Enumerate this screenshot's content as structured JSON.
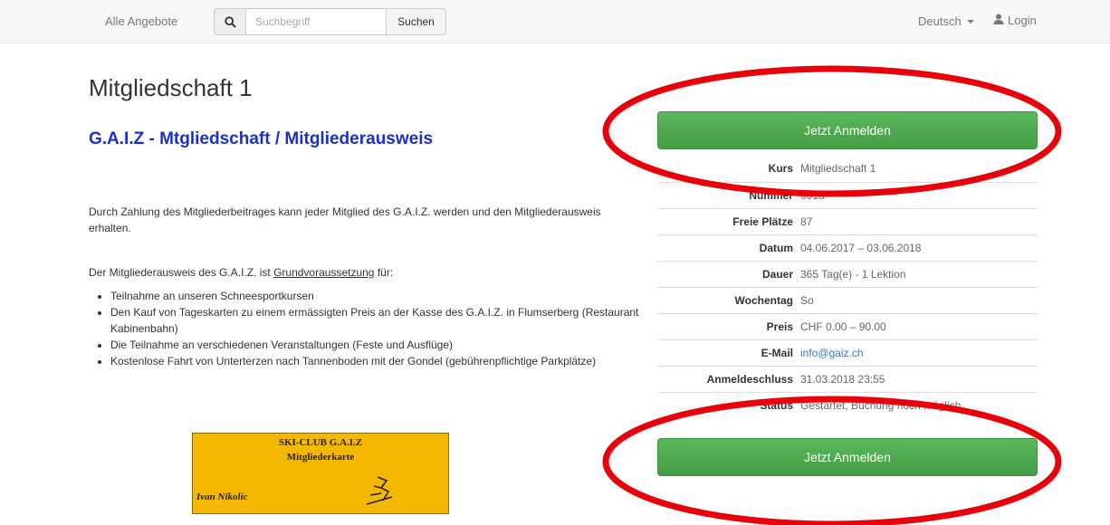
{
  "navbar": {
    "brand": "Alle Angebote",
    "search_placeholder": "Suchbegriff",
    "search_button": "Suchen",
    "language": "Deutsch",
    "login": "Login"
  },
  "main": {
    "title": "Mitgliedschaft 1",
    "subtitle": "G.A.I.Z - Mtgliedschaft / Mitgliederausweis",
    "paragraph1": "Durch Zahlung des Mitgliederbeitrages kann jeder Mitglied des G.A.I.Z. werden und den Mitgliederausweis erhalten.",
    "paragraph2_prefix": "Der Mitgliederausweis des G.A.I.Z. ist ",
    "paragraph2_link": "Grundvoraussetzung",
    "paragraph2_suffix": " für:",
    "bullets": [
      "Teilnahme an unseren Schneesportkursen",
      "Den Kauf von Tageskarten zu einem ermässigten Preis an der Kasse des G.A.I.Z. in Flumserberg (Restaurant Kabinenbahn)",
      "Die Teilnahme an verschiedenen Veranstaltungen (Feste und Ausflüge)",
      "Kostenlose Fahrt von Unterterzen nach Tannenboden mit der Gondel (gebührenpflichtige Parkplätze)"
    ],
    "card": {
      "line1": "SKI-CLUB G.A.I.Z",
      "line2": "Mitgliederkarte",
      "name": "Ivan Nikolic"
    }
  },
  "sidebar": {
    "enroll_button": "Jetzt Anmelden",
    "details": [
      {
        "label": "Kurs",
        "value": "Mitgliedschaft 1"
      },
      {
        "label": "Nummer",
        "value": "001a"
      },
      {
        "label": "Freie Plätze",
        "value": "87"
      },
      {
        "label": "Datum",
        "value": "04.06.2017 – 03.06.2018"
      },
      {
        "label": "Dauer",
        "value": "365 Tag(e) - 1 Lektion"
      },
      {
        "label": "Wochentag",
        "value": "So"
      },
      {
        "label": "Preis",
        "value": "CHF 0.00 – 90.00"
      },
      {
        "label": "E-Mail",
        "value": "info@gaiz.ch"
      },
      {
        "label": "Anmeldeschluss",
        "value": "31.03.2018 23:55"
      },
      {
        "label": "Status",
        "value": "Gestartet, Buchung noch möglich"
      }
    ]
  },
  "colors": {
    "annotation_red": "#e8000b",
    "button_green": "#5cb85c",
    "subtitle_blue": "#1b2fc9",
    "link_blue": "#337ab7"
  }
}
